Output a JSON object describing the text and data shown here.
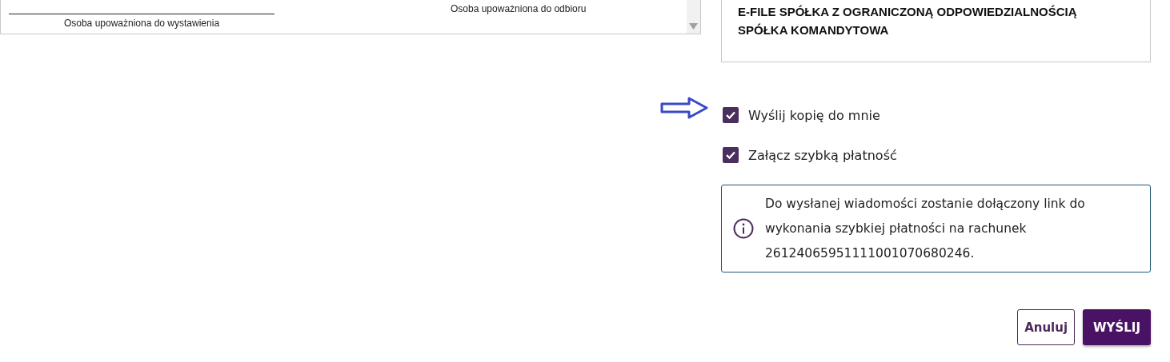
{
  "preview": {
    "issuer_label": "Osoba upoważniona do wystawienia",
    "receiver_label": "Osoba upoważniona do odbioru"
  },
  "recipient": {
    "name_lines": [
      "E-FILE SPÓŁKA Z OGRANICZONĄ ODPOWIEDZIALNOŚCIĄ",
      "SPÓŁKA KOMANDYTOWA"
    ]
  },
  "options": [
    {
      "label": "Wyślij kopię do mnie",
      "checked": true,
      "pointer_arrow": true
    },
    {
      "label": "Załącz szybką płatność",
      "checked": true,
      "pointer_arrow": false
    }
  ],
  "info": {
    "text": "Do wysłanej wiadomości zostanie dołączony link do wykonania szybkiej płatności na rachunek 26124065951111001070680246."
  },
  "buttons": [
    {
      "label": "Anuluj",
      "kind": "secondary"
    },
    {
      "label": "WYŚLIJ",
      "kind": "primary"
    }
  ]
}
